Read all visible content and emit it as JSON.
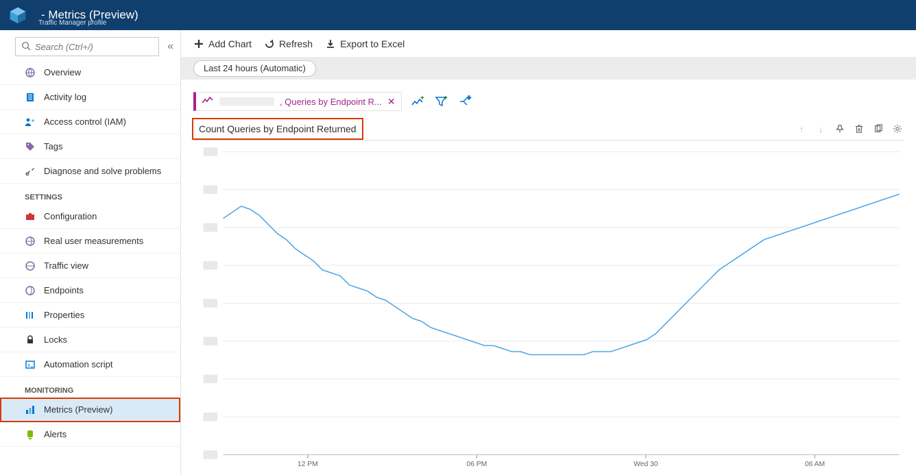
{
  "header": {
    "title": " - Metrics (Preview)",
    "subtitle": "Traffic Manager profile"
  },
  "search": {
    "placeholder": "Search (Ctrl+/)"
  },
  "nav": {
    "top": [
      {
        "label": "Overview",
        "icon": "globe"
      },
      {
        "label": "Activity log",
        "icon": "log"
      },
      {
        "label": "Access control (IAM)",
        "icon": "iam"
      },
      {
        "label": "Tags",
        "icon": "tag"
      },
      {
        "label": "Diagnose and solve problems",
        "icon": "wrench"
      }
    ],
    "section1": "SETTINGS",
    "settings": [
      {
        "label": "Configuration",
        "icon": "briefcase"
      },
      {
        "label": "Real user measurements",
        "icon": "globe"
      },
      {
        "label": "Traffic view",
        "icon": "globe"
      },
      {
        "label": "Endpoints",
        "icon": "globe"
      },
      {
        "label": "Properties",
        "icon": "props"
      },
      {
        "label": "Locks",
        "icon": "lock"
      },
      {
        "label": "Automation script",
        "icon": "script"
      }
    ],
    "section2": "MONITORING",
    "monitoring": [
      {
        "label": "Metrics (Preview)",
        "icon": "barchart",
        "selected": true
      },
      {
        "label": "Alerts",
        "icon": "alert"
      }
    ]
  },
  "toolbar": {
    "addChart": "Add Chart",
    "refresh": "Refresh",
    "export": "Export to Excel"
  },
  "filter": {
    "range": "Last 24 hours (Automatic)"
  },
  "metricChip": {
    "text": ", Queries by Endpoint R..."
  },
  "chart": {
    "title": "Count Queries by Endpoint Returned"
  },
  "chart_data": {
    "type": "line",
    "title": "Count Queries by Endpoint Returned",
    "xlabel": "",
    "ylabel": "",
    "x_ticks": [
      "12 PM",
      "06 PM",
      "Wed 30",
      "06 AM"
    ],
    "y_grid_count": 9,
    "series": [
      {
        "name": "Queries by Endpoint Returned",
        "values_pct_of_ymax": [
          78,
          80,
          82,
          81,
          79,
          76,
          73,
          71,
          68,
          66,
          64,
          61,
          60,
          59,
          56,
          55,
          54,
          52,
          51,
          49,
          47,
          45,
          44,
          42,
          41,
          40,
          39,
          38,
          37,
          36,
          36,
          35,
          34,
          34,
          33,
          33,
          33,
          33,
          33,
          33,
          33,
          34,
          34,
          34,
          35,
          36,
          37,
          38,
          40,
          43,
          46,
          49,
          52,
          55,
          58,
          61,
          63,
          65,
          67,
          69,
          71,
          72,
          73,
          74,
          75,
          76,
          77,
          78,
          79,
          80,
          81,
          82,
          83,
          84,
          85,
          86
        ]
      }
    ],
    "note": "Y-axis tick labels redacted in source image; values given as percentage of visible y-range (0–100) estimated from the rendered curve."
  }
}
